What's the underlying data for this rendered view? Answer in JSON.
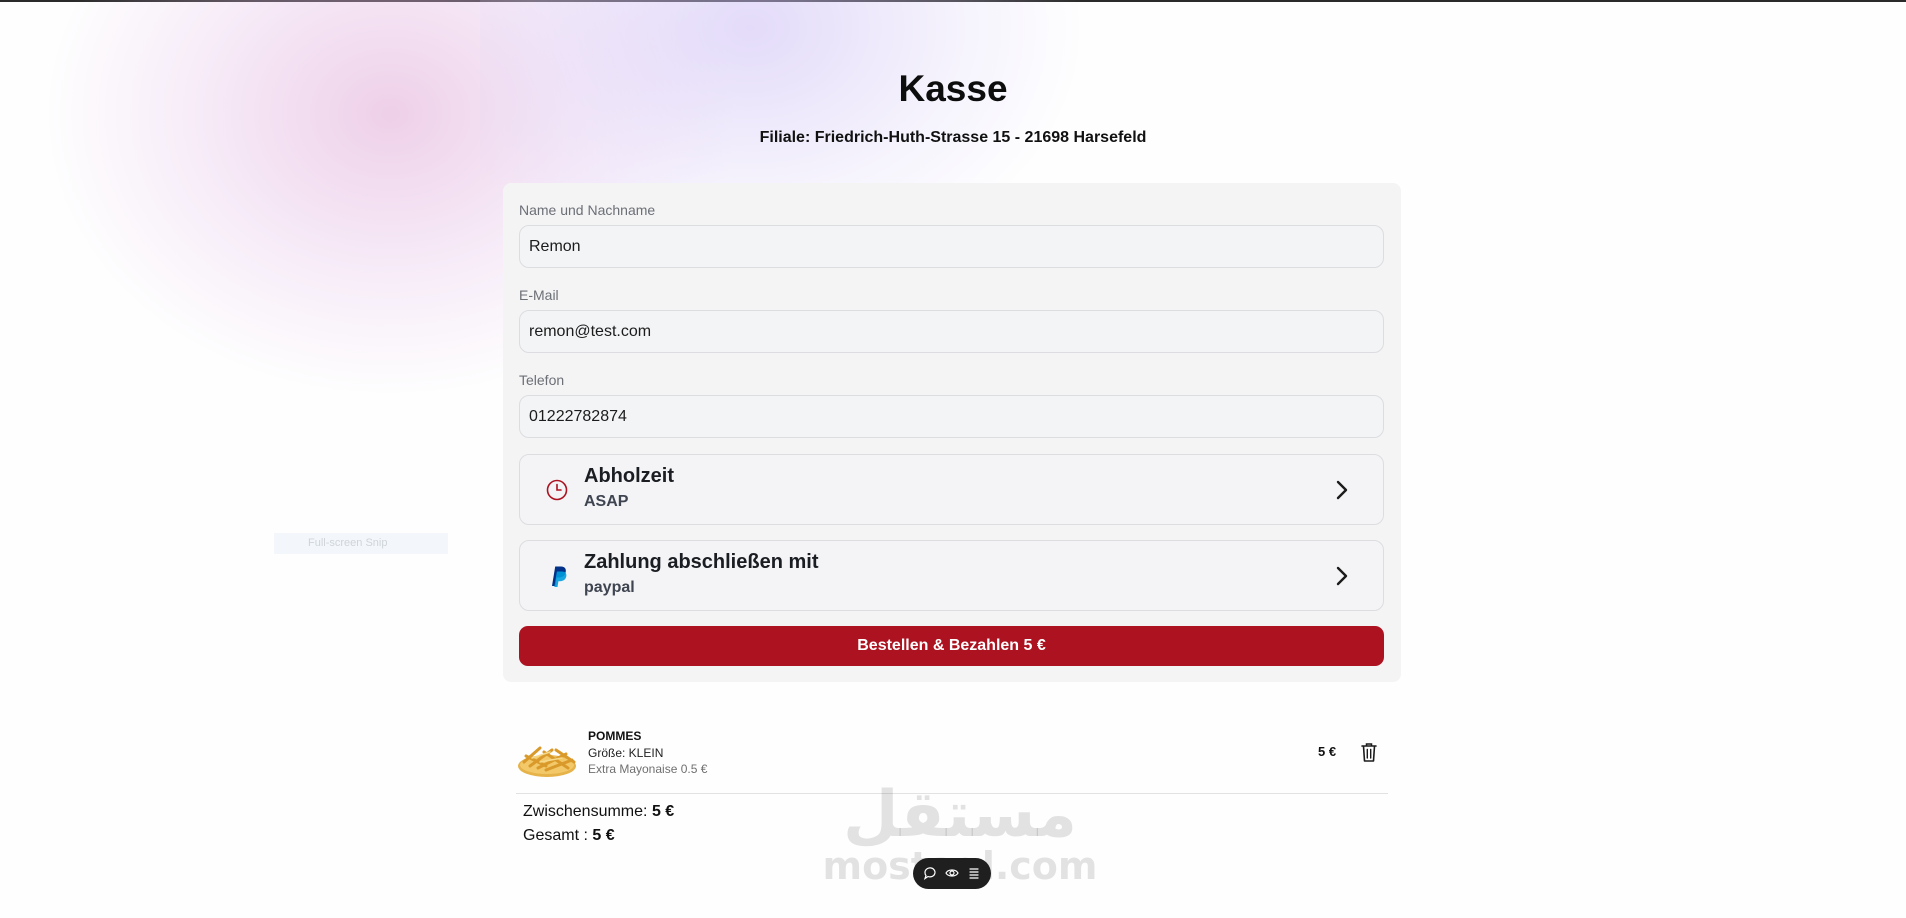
{
  "page": {
    "title": "Kasse",
    "branch": "Filiale: Friedrich-Huth-Strasse 15 - 21698 Harsefeld"
  },
  "form": {
    "name_label": "Name und Nachname",
    "name_value": "Remon",
    "email_label": "E-Mail",
    "email_value": "remon@test.com",
    "phone_label": "Telefon",
    "phone_value": "01222782874"
  },
  "pickup": {
    "title": "Abholzeit",
    "value": "ASAP",
    "icon": "clock-icon"
  },
  "payment": {
    "title": "Zahlung abschließen mit",
    "value": "paypal",
    "icon": "paypal-icon"
  },
  "order_button": {
    "label": "Bestellen & Bezahlen 5 €"
  },
  "cart": {
    "items": [
      {
        "name": "POMMES",
        "size": "Größe: KLEIN",
        "extra": "Extra Mayonaise 0.5 €",
        "price": "5 €",
        "image": "fries-image"
      }
    ]
  },
  "totals": {
    "subtotal_label": "Zwischensumme:",
    "subtotal_value": "5 €",
    "total_label": "Gesamt :",
    "total_value": "5 €"
  },
  "overlay": {
    "snip_label": "Full-screen Snip",
    "watermark_arabic": "مستقل",
    "watermark_latin": "mostaql.com"
  },
  "colors": {
    "accent": "#ac1220",
    "paypal_dark": "#003087",
    "paypal_light": "#009cde"
  }
}
